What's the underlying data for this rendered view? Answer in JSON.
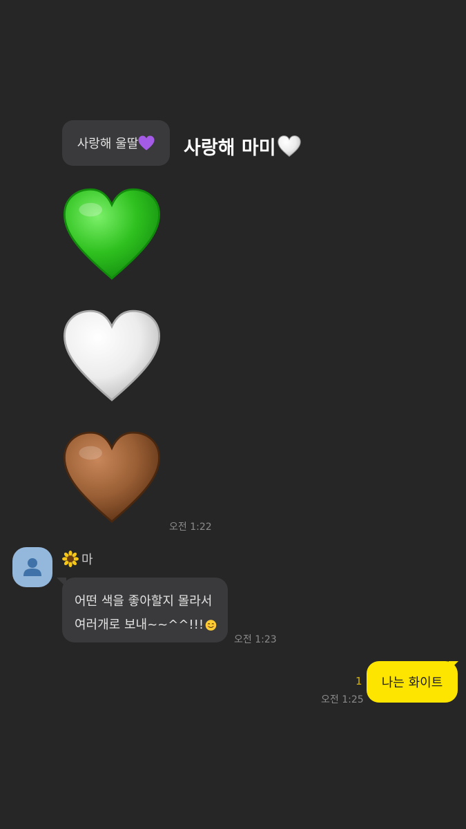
{
  "messages": {
    "first_bubble": "사랑해 울딸",
    "first_bubble_emoji": "purple-heart",
    "loud_text": "사랑해 마미",
    "loud_text_emoji": "white-heart",
    "big_emojis": [
      "green-heart",
      "white-heart",
      "brown-heart"
    ],
    "time_1": "오전 1:22",
    "sender_name": "마",
    "sender_emoji": "sunflower",
    "incoming_line_1": "어떤 색을 좋아할지 몰라서",
    "incoming_line_2": "여러개로 보내~~^^!!!",
    "incoming_emoji": "smiling-face",
    "time_2": "오전 1:23",
    "outgoing": "나는 화이트",
    "unread_count": "1",
    "time_3": "오전 1:25"
  },
  "colors": {
    "background": "#262626",
    "incoming_bubble": "#3a3a3c",
    "outgoing_bubble": "#fee500",
    "avatar": "#94b7dc",
    "green_heart": "#35c52a",
    "white_heart": "#ececec",
    "brown_heart": "#8a5530",
    "purple_heart": "#a45be6"
  }
}
